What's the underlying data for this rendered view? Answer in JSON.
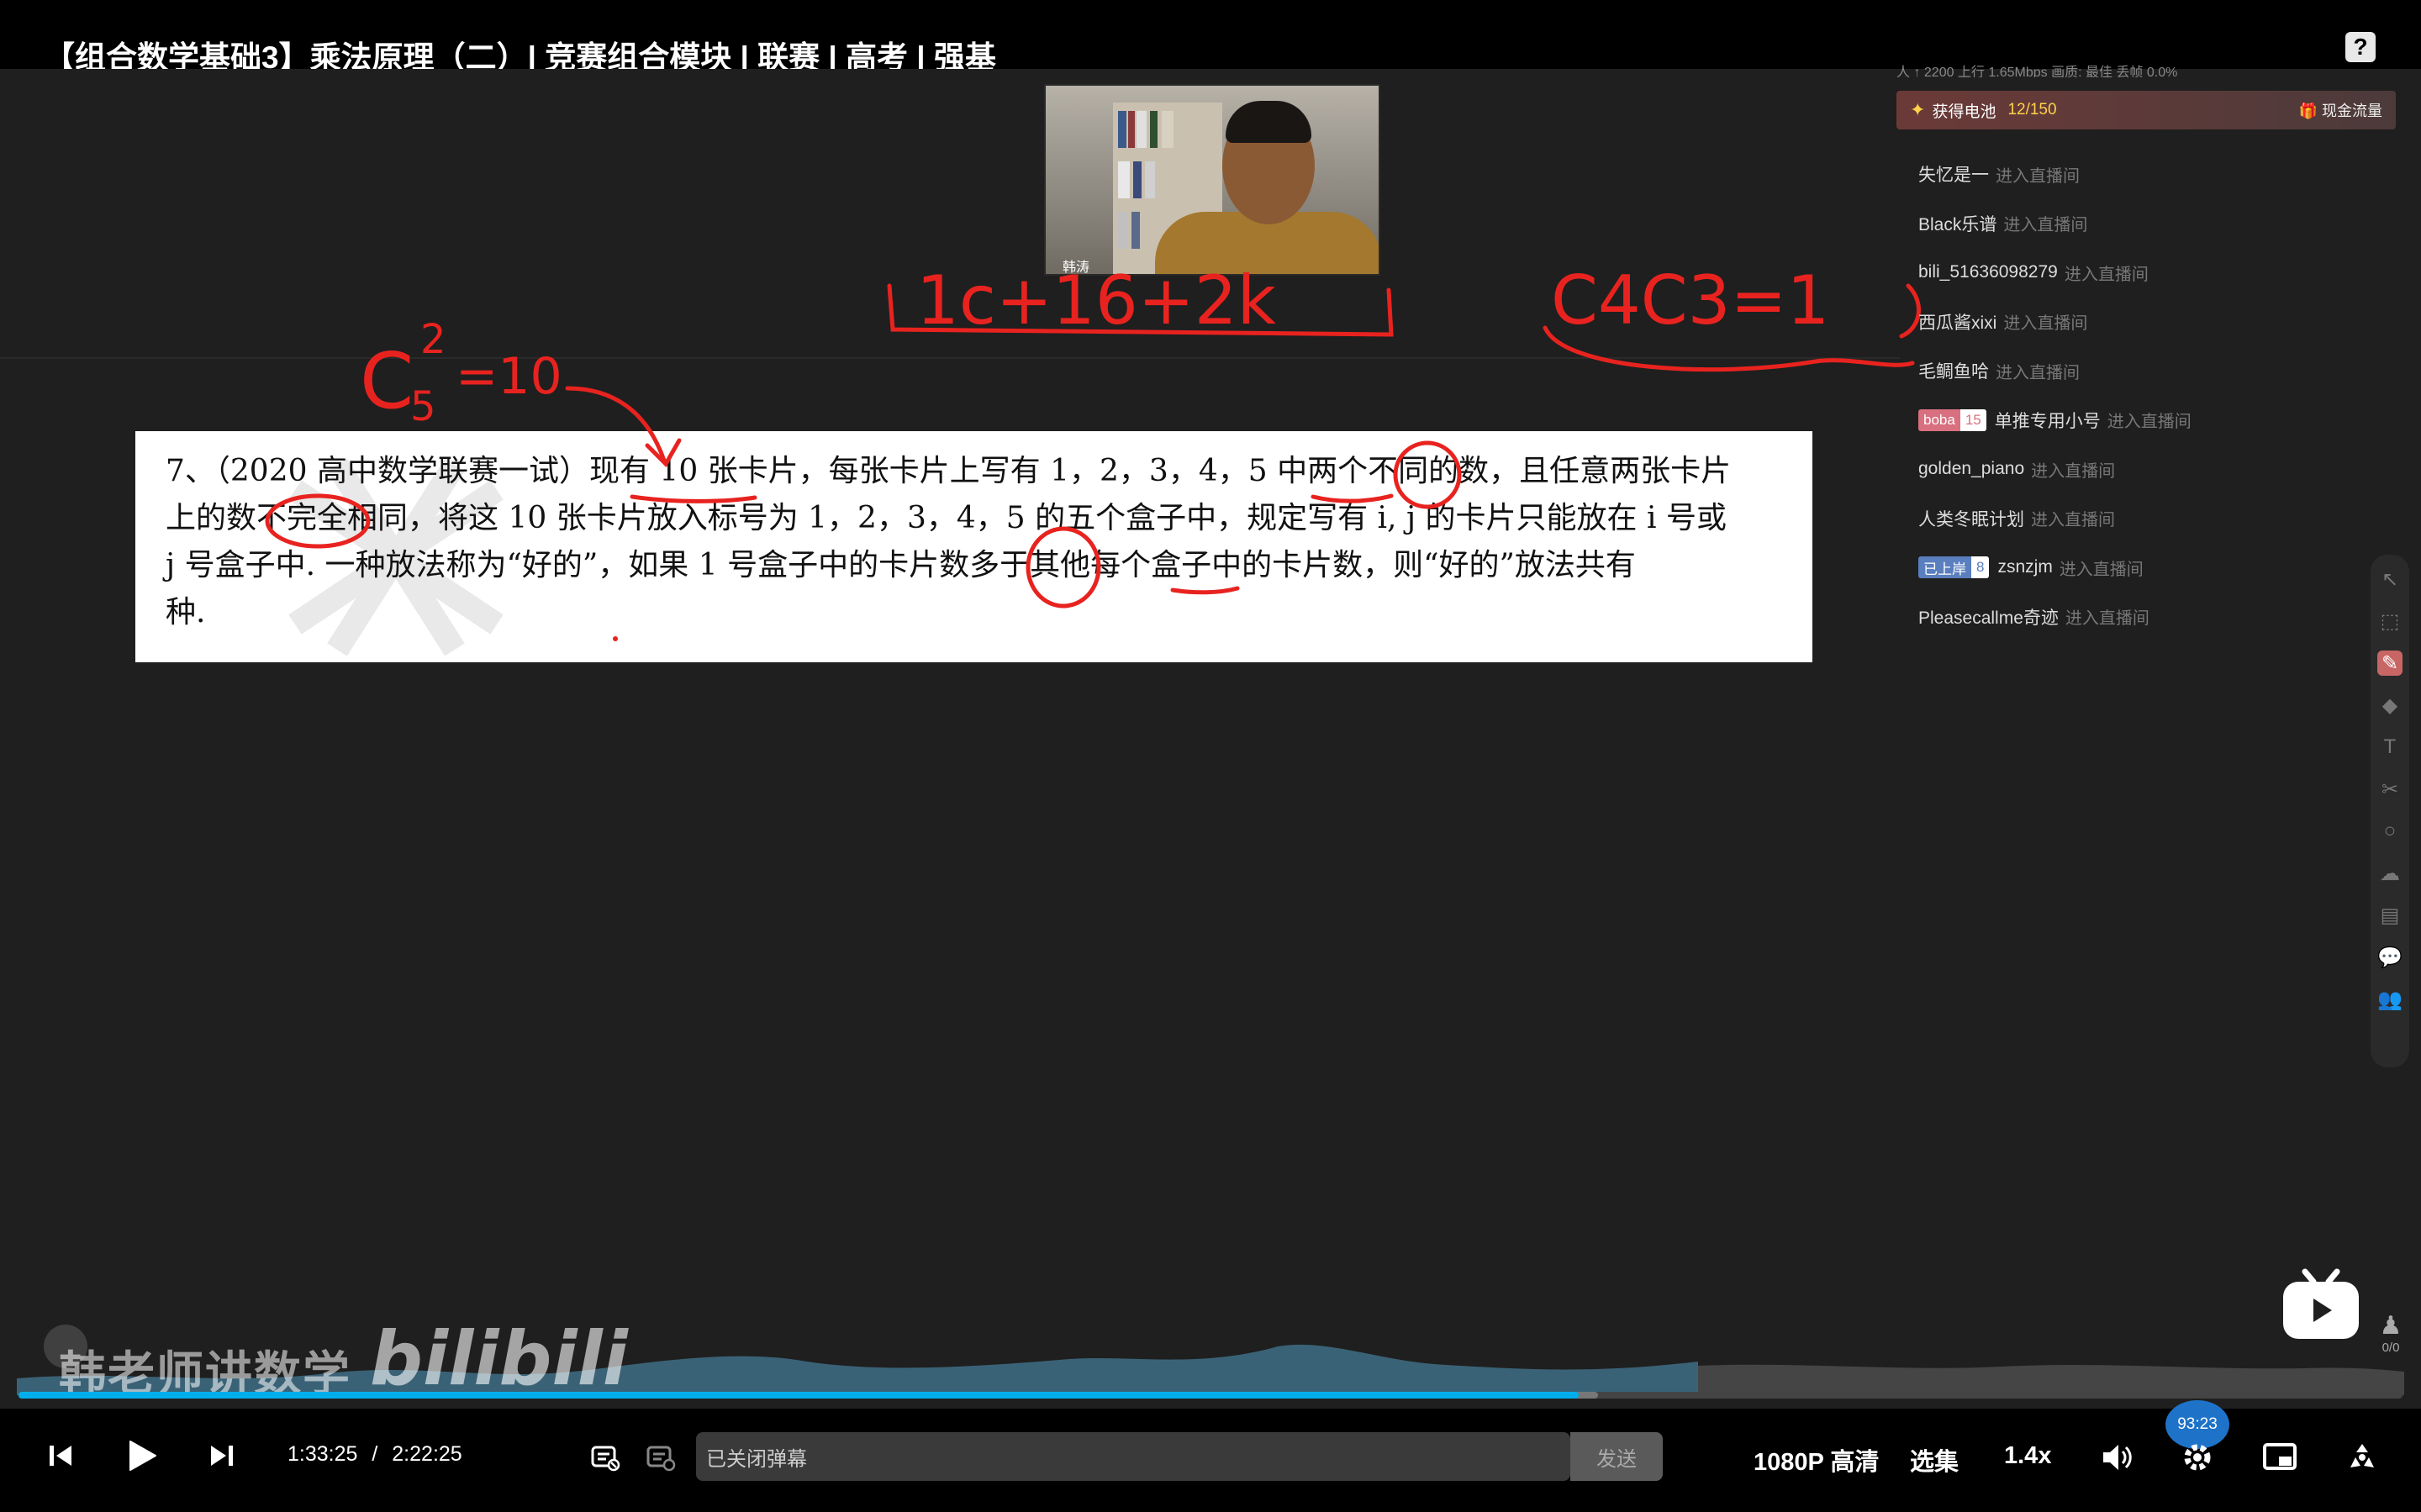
{
  "window": {
    "title": "【组合数学基础3】乘法原理（二）| 竞赛组合模块 | 联赛 | 高考 | 强基"
  },
  "webcam": {
    "name_label": "韩涛"
  },
  "chat": {
    "stats": "人 ↑ 2200    上行 1.65Mbps   画质: 最佳   丢帧 0.0%",
    "battery": {
      "label": "获得电池",
      "count": "12/150",
      "flow_label": "现金流量"
    },
    "enter_text": "进入直播间",
    "items": [
      {
        "name": "失忆是一"
      },
      {
        "name": "Black乐谱"
      },
      {
        "name": "bili_51636098279"
      },
      {
        "name": "西瓜酱xixi"
      },
      {
        "name": "毛鲷鱼哈"
      },
      {
        "name": "单推专用小号",
        "badge": "boba",
        "badge_level": "15",
        "badge_color": "#d9707f"
      },
      {
        "name": "golden_piano"
      },
      {
        "name": "人类冬眠计划"
      },
      {
        "name": "zsnzjm",
        "badge": "已上岸",
        "badge_level": "8",
        "badge_color": "#5a7fbf"
      },
      {
        "name": "Pleasecallme奇迹"
      }
    ]
  },
  "problem": {
    "line1": "7、（2020 高中数学联赛一试）现有 10 张卡片，每张卡片上写有 1，2，3，4，5 中两个不同的数，且任意两张卡片",
    "line2": "上的数不完全相同，将这 10 张卡片放入标号为 1，2，3，4，5 的五个盒子中，规定写有 i, j 的卡片只能放在 i 号或",
    "line3": "j 号盒子中. 一种放法称为“好的”，如果 1 号盒子中的卡片数多于其他每个盒子中的卡片数，则“好的”放法共有",
    "line4": "种."
  },
  "annotations": {
    "formula_base": "C",
    "formula_sup": "2",
    "formula_sub": "5",
    "formula_rest": "=10",
    "board_top_left": "1c+16+2k",
    "board_top_right": "C4C3=1"
  },
  "overlay": {
    "uploader": "韩老师讲数学",
    "logo_text": "bilibili",
    "mini_counter": "0/0"
  },
  "player": {
    "progress_fraction": 0.6546,
    "buffer_fraction": 0.6626,
    "current_time": "1:33:25",
    "separator": "/",
    "total_time": "2:22:25",
    "danmu_placeholder": "已关闭弹幕",
    "send_label": "发送",
    "quality_label": "1080P 高清",
    "episodes_label": "选集",
    "speed_label": "1.4x",
    "speed_badge": "93:23"
  },
  "colors": {
    "accent": "#00aeec",
    "annotation_red": "#e8231f"
  }
}
